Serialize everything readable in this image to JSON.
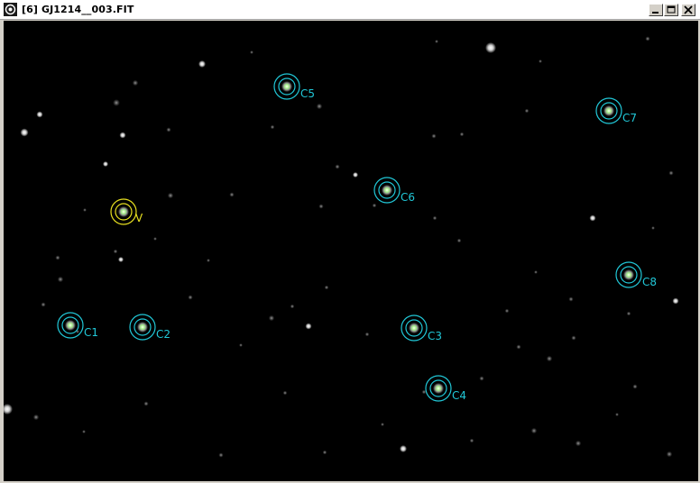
{
  "window": {
    "title": "[6] GJ1214__003.FIT",
    "controls": [
      "minimize",
      "maximize",
      "close"
    ]
  },
  "colors": {
    "variable_marker": "#e8e020",
    "comparison_marker": "#21c8d8",
    "star_core": "#9ef27a",
    "background": "#000000"
  },
  "markers": {
    "variable": [
      {
        "label": "V"
      }
    ],
    "comparison": [
      {
        "label": "C1"
      },
      {
        "label": "C2"
      },
      {
        "label": "C3"
      },
      {
        "label": "C4"
      },
      {
        "label": "C5"
      },
      {
        "label": "C6"
      },
      {
        "label": "C7"
      },
      {
        "label": "C8"
      }
    ]
  }
}
